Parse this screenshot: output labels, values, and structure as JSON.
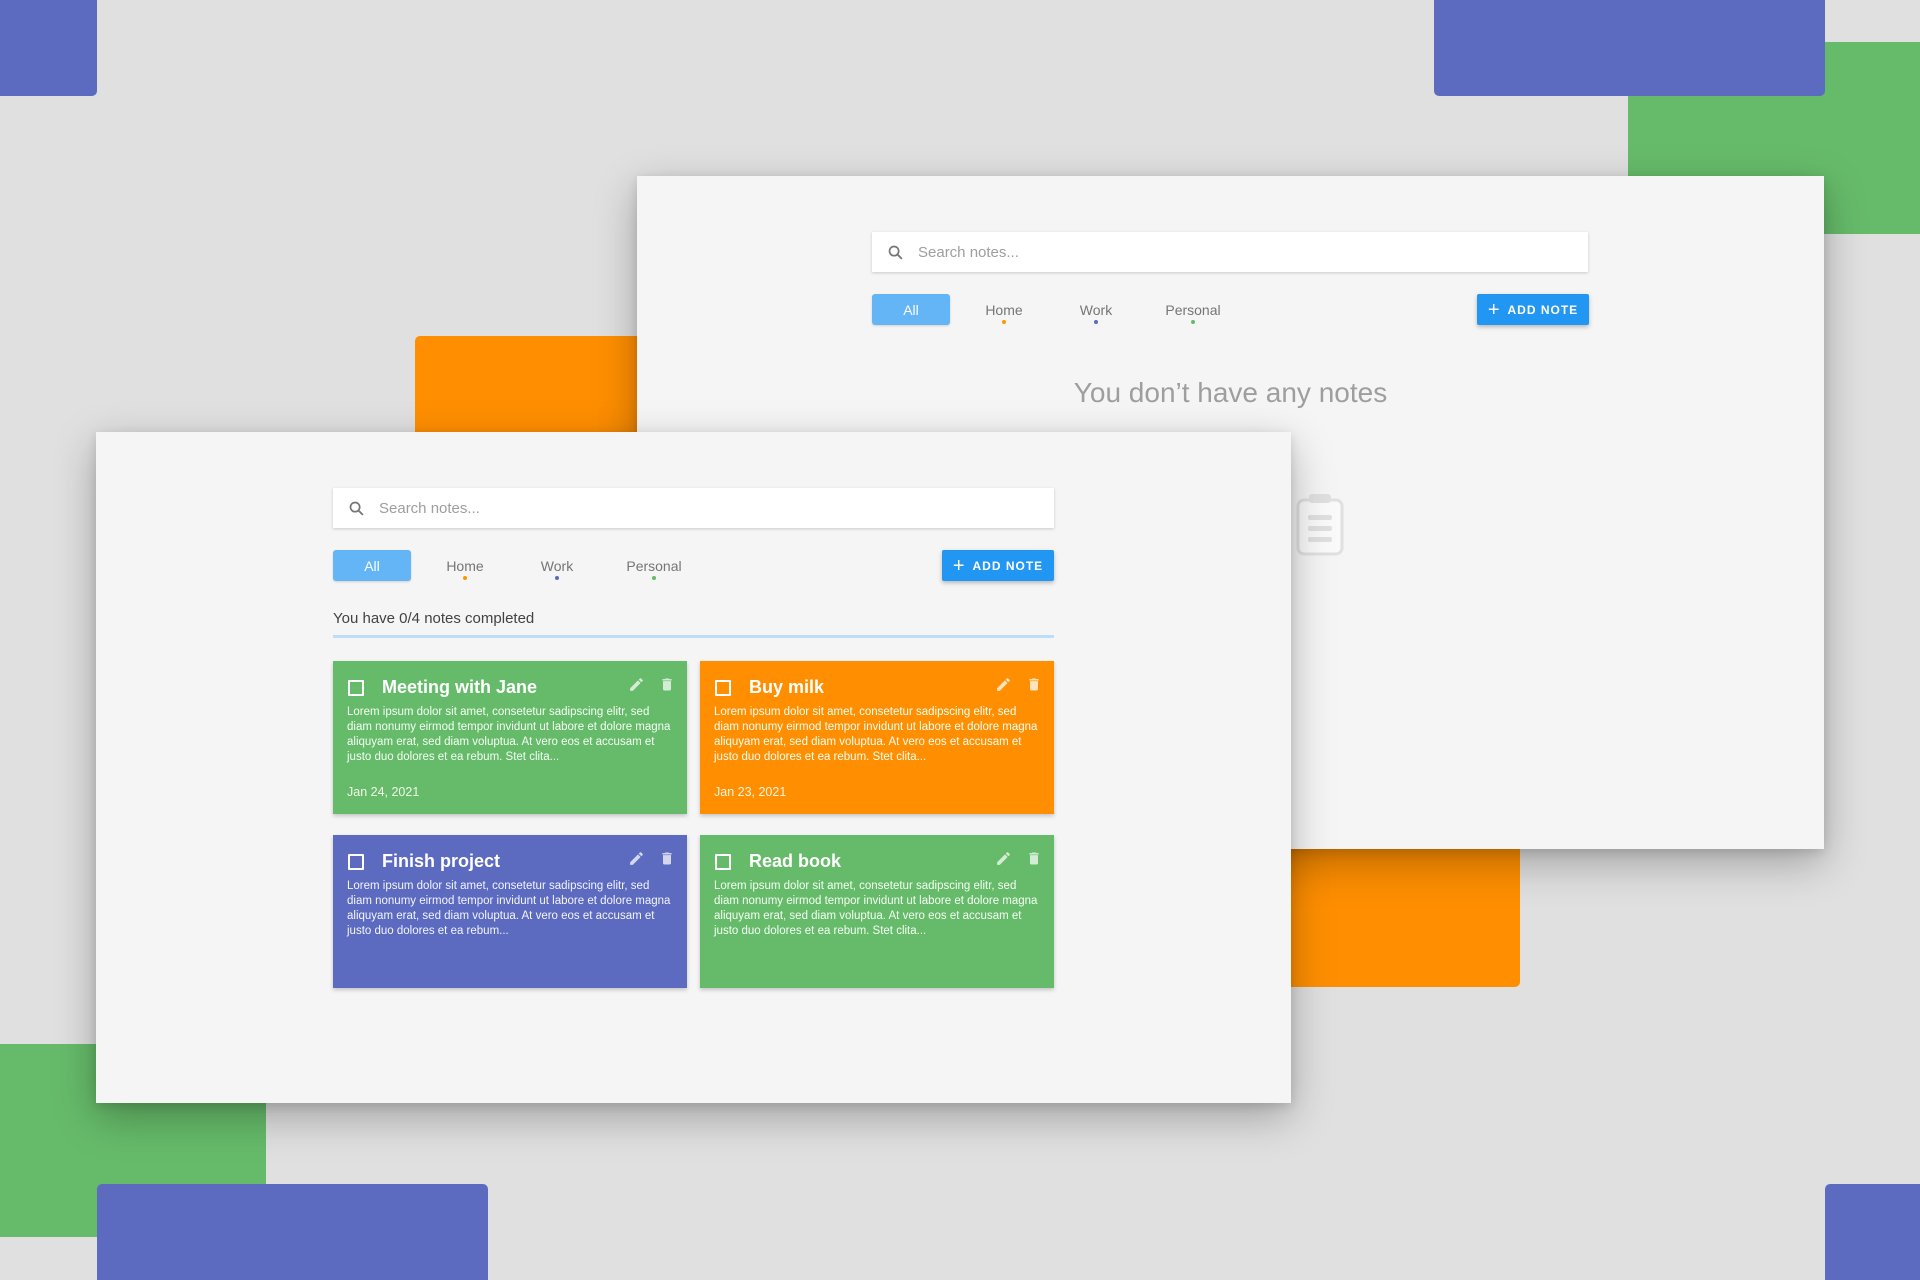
{
  "colors": {
    "background": "#e0e0e0",
    "indigo": "#5c6bc0",
    "green": "#66bb6a",
    "orange": "#ff8f00",
    "accent_blue": "#2196f3",
    "chip_active": "#64b5f6",
    "window": "#f5f5f5"
  },
  "back_window": {
    "search": {
      "placeholder": "Search notes..."
    },
    "filters": [
      {
        "label": "All",
        "active": true,
        "dot": null
      },
      {
        "label": "Home",
        "active": false,
        "dot": "#ff9800"
      },
      {
        "label": "Work",
        "active": false,
        "dot": "#5c6bc0"
      },
      {
        "label": "Personal",
        "active": false,
        "dot": "#66bb6a"
      }
    ],
    "add_button": {
      "label": "ADD NOTE",
      "icon": "plus-icon"
    },
    "empty_state": {
      "message": "You don’t have any notes",
      "icon": "clipboard-icon"
    }
  },
  "front_window": {
    "search": {
      "placeholder": "Search notes..."
    },
    "filters": [
      {
        "label": "All",
        "active": true,
        "dot": null
      },
      {
        "label": "Home",
        "active": false,
        "dot": "#ff9800"
      },
      {
        "label": "Work",
        "active": false,
        "dot": "#5c6bc0"
      },
      {
        "label": "Personal",
        "active": false,
        "dot": "#66bb6a"
      }
    ],
    "add_button": {
      "label": "ADD NOTE",
      "icon": "plus-icon"
    },
    "status": "You have 0/4 notes completed",
    "notes": [
      {
        "title": "Meeting with Jane",
        "body": "Lorem ipsum dolor sit amet, consetetur sadipscing elitr, sed diam nonumy eirmod tempor invidunt ut labore et dolore magna aliquyam erat, sed diam voluptua. At vero eos et accusam et justo duo dolores et ea rebum. Stet clita...",
        "date": "Jan 24, 2021",
        "color": "#66bb6a",
        "checked": false
      },
      {
        "title": "Buy milk",
        "body": "Lorem ipsum dolor sit amet, consetetur sadipscing elitr, sed diam nonumy eirmod tempor invidunt ut labore et dolore magna aliquyam erat, sed diam voluptua. At vero eos et accusam et justo duo dolores et ea rebum. Stet clita...",
        "date": "Jan 23, 2021",
        "color": "#ff8f00",
        "checked": false
      },
      {
        "title": "Finish project",
        "body": "Lorem ipsum dolor sit amet, consetetur sadipscing elitr, sed diam nonumy eirmod tempor invidunt ut labore et dolore magna aliquyam erat, sed diam voluptua. At vero eos et accusam et justo duo dolores et ea rebum...",
        "date": "",
        "color": "#5c6bc0",
        "checked": false
      },
      {
        "title": "Read book",
        "body": "Lorem ipsum dolor sit amet, consetetur sadipscing elitr, sed diam nonumy eirmod tempor invidunt ut labore et dolore magna aliquyam erat, sed diam voluptua. At vero eos et accusam et justo duo dolores et ea rebum. Stet clita...",
        "date": "",
        "color": "#66bb6a",
        "checked": false
      }
    ]
  }
}
